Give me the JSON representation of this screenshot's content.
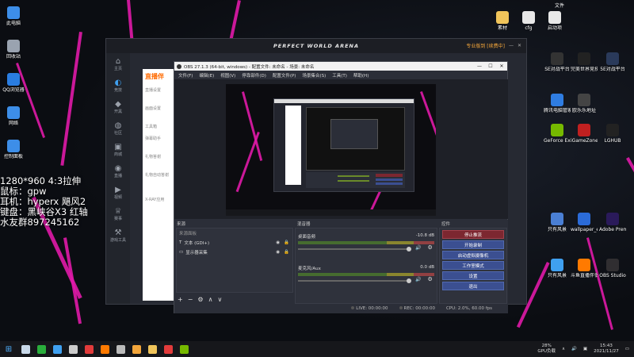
{
  "overlay_text": [
    "1280*960 4:3拉伸",
    "鼠标：gpw",
    "耳机：hyperx 飓风2",
    "键盘：黑峡谷X3 红轴",
    "水友群897245162"
  ],
  "desktop_left": [
    {
      "label": "此电脑",
      "icon": "computer-icon",
      "color": "#3d8ee8"
    },
    {
      "label": "回收站",
      "icon": "recycle-bin-icon",
      "color": "#9aa3b0"
    },
    {
      "label": "QQ浏览器",
      "icon": "qq-browser-icon",
      "color": "#2a7de1"
    },
    {
      "label": "网络",
      "icon": "network-icon",
      "color": "#3d8ee8"
    },
    {
      "label": "控制面板",
      "icon": "control-panel-icon",
      "color": "#3d8ee8"
    }
  ],
  "desktop_topright": [
    {
      "label": "素材",
      "icon": "folder-icon",
      "color": "#f0c45a"
    },
    {
      "label": "cfg",
      "icon": "file-icon",
      "color": "#e8e8e8"
    },
    {
      "label": "启动项",
      "icon": "file-icon",
      "color": "#e8e8e8"
    }
  ],
  "desktop_top_label": "文件",
  "desktop_right": [
    {
      "label": "SE对战平台",
      "icon": "se-icon",
      "color": "#333"
    },
    {
      "label": "完美世界竞技平台",
      "icon": "pwa-icon",
      "color": "#222"
    },
    {
      "label": "5E对战平台",
      "icon": "5e-icon",
      "color": "#2a3a5a"
    },
    {
      "label": "腾讯电脑管家",
      "icon": "tencent-icon",
      "color": "#2f7de2"
    },
    {
      "label": "欧乐乐地址",
      "icon": "app-icon",
      "color": "#444"
    },
    {
      "label": "GeForce Experience",
      "icon": "nvidia-icon",
      "color": "#76b900"
    },
    {
      "label": "iGameZone II",
      "icon": "igame-icon",
      "color": "#c02020"
    },
    {
      "label": "LGHUB",
      "icon": "lghub-icon",
      "color": "#222"
    },
    {
      "label": "只有风景",
      "icon": "app-icon",
      "color": "#4a7fd4"
    },
    {
      "label": "wallpaper_engine",
      "icon": "wallpaper-icon",
      "color": "#2b6bd8"
    },
    {
      "label": "Adobe Premiere Pro 2021",
      "icon": "premiere-icon",
      "color": "#2a1a5a"
    },
    {
      "label": "斗鱼直播伴侣",
      "icon": "douyu-icon",
      "color": "#ff7a00"
    },
    {
      "label": "OBS Studio",
      "icon": "obs-icon",
      "color": "#302e31"
    },
    {
      "label": "只有风景",
      "icon": "app-icon",
      "color": "#3fa0f0"
    }
  ],
  "pwa": {
    "title": "PERFECT WORLD ARENA",
    "account": "专业版到 [续费中]",
    "sidebar": [
      "主页",
      "竞技",
      "开黑",
      "社区",
      "商城",
      "直播",
      "视频",
      "赛事",
      "游戏工具"
    ],
    "live_logo": "直播伴",
    "live_menu": [
      "直播设置",
      "",
      "画面设置",
      "",
      "工具箱",
      "弹幕助手",
      "",
      "礼物答谢",
      "",
      "礼物自动答谢",
      "",
      "",
      "X-RAY应用"
    ]
  },
  "obs": {
    "title": "OBS 27.1.3 (64-bit, windows) - 配置文件: 未命名 - 场景: 未命名",
    "menu": [
      "文件(F)",
      "编辑(E)",
      "视图(V)",
      "停靠部件(D)",
      "配置文件(P)",
      "场景集合(S)",
      "工具(T)",
      "帮助(H)"
    ],
    "dock": {
      "sources_title": "来源",
      "sources_header": "来源面板",
      "sources": [
        {
          "label": "文本 (GDI+)",
          "icon": "text-icon"
        },
        {
          "label": "显示器采集",
          "icon": "monitor-icon"
        }
      ],
      "mixer_title": "混音器",
      "mixer": [
        {
          "label": "桌面音频",
          "value": "-10.8 dB"
        },
        {
          "label": "麦克风/Aux",
          "value": "0.0 dB"
        }
      ],
      "controls_title": "控件",
      "controls": [
        "停止推流",
        "开始录制",
        "启动虚拟摄像机",
        "工作室模式",
        "设置",
        "退出"
      ],
      "source_buttons": [
        "+",
        "−",
        "⚙",
        "∧",
        "∨"
      ]
    },
    "status": {
      "live": "LIVE: 00:00:00",
      "rec": "REC: 00:00:00",
      "cpu": "CPU: 2.0%, 60.00 fps"
    }
  },
  "taskbar": {
    "apps": [
      {
        "icon": "steam-icon",
        "color": "#c8d8e8"
      },
      {
        "icon": "wechat-icon",
        "color": "#2aae3c"
      },
      {
        "icon": "qq-icon",
        "color": "#3fa0f0"
      },
      {
        "icon": "ggg-icon",
        "color": "#ccc"
      },
      {
        "icon": "netease-icon",
        "color": "#e23b3b"
      },
      {
        "icon": "douyu-icon",
        "color": "#ff7a00"
      },
      {
        "icon": "obs-icon",
        "color": "#bbb"
      },
      {
        "icon": "pwa-icon",
        "color": "#f3a63b"
      },
      {
        "icon": "folder-icon",
        "color": "#f0c45a"
      },
      {
        "icon": "game-icon",
        "color": "#e23b3b"
      },
      {
        "icon": "nvidia-icon",
        "color": "#76b900"
      }
    ],
    "gpu": "28%",
    "gpu_label": "GPU负载",
    "time": "15:43",
    "date": "2021/11/27"
  }
}
